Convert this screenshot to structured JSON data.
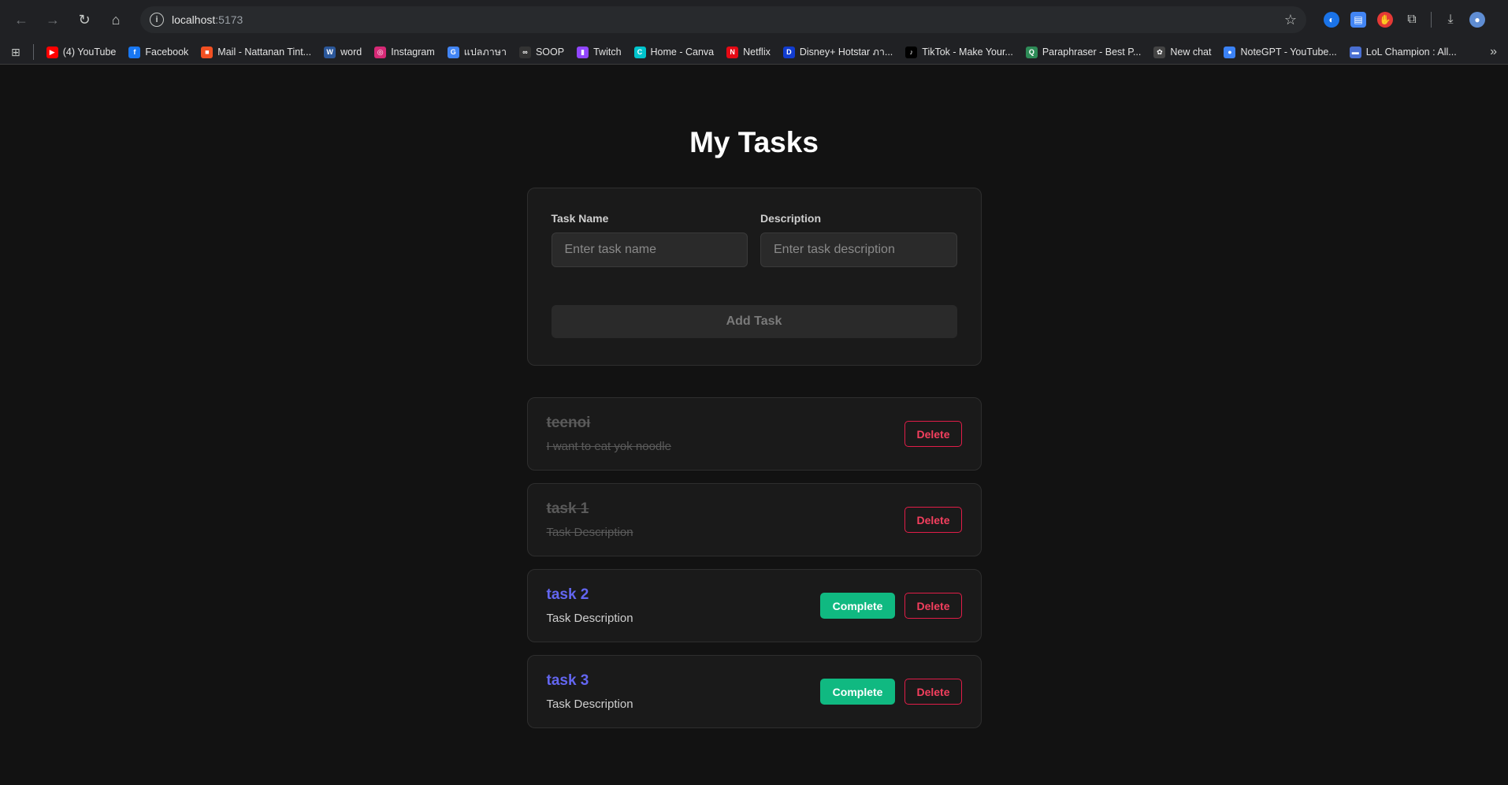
{
  "browser": {
    "url_host": "localhost",
    "url_port": ":5173",
    "bookmarks": [
      {
        "label": "(4) YouTube",
        "icon": "youtube-icon",
        "color": "#ff0000",
        "glyph": "▶"
      },
      {
        "label": "Facebook",
        "icon": "facebook-icon",
        "color": "#1877f2",
        "glyph": "f"
      },
      {
        "label": "Mail - Nattanan Tint...",
        "icon": "microsoft-icon",
        "color": "#f25022",
        "glyph": "■"
      },
      {
        "label": "word",
        "icon": "word-icon",
        "color": "#2b579a",
        "glyph": "W"
      },
      {
        "label": "Instagram",
        "icon": "instagram-icon",
        "color": "#d62976",
        "glyph": "◎"
      },
      {
        "label": "แปลภาษา",
        "icon": "translate-icon",
        "color": "#4285f4",
        "glyph": "G"
      },
      {
        "label": "SOOP",
        "icon": "soop-icon",
        "color": "#333333",
        "glyph": "∞"
      },
      {
        "label": "Twitch",
        "icon": "twitch-icon",
        "color": "#9146ff",
        "glyph": "▮"
      },
      {
        "label": "Home - Canva",
        "icon": "canva-icon",
        "color": "#00c4cc",
        "glyph": "C"
      },
      {
        "label": "Netflix",
        "icon": "netflix-icon",
        "color": "#e50914",
        "glyph": "N"
      },
      {
        "label": "Disney+ Hotstar ภา...",
        "icon": "disney-icon",
        "color": "#113ccf",
        "glyph": "D"
      },
      {
        "label": "TikTok - Make Your...",
        "icon": "tiktok-icon",
        "color": "#000000",
        "glyph": "♪"
      },
      {
        "label": "Paraphraser - Best P...",
        "icon": "paraphraser-icon",
        "color": "#2e8b57",
        "glyph": "Q"
      },
      {
        "label": "New chat",
        "icon": "chatgpt-icon",
        "color": "#444444",
        "glyph": "✿"
      },
      {
        "label": "NoteGPT - YouTube...",
        "icon": "notegpt-icon",
        "color": "#3b82f6",
        "glyph": "●"
      },
      {
        "label": "LoL Champion : All...",
        "icon": "lol-icon",
        "color": "#4a6fd1",
        "glyph": "▬"
      }
    ]
  },
  "app": {
    "title": "My Tasks",
    "form": {
      "name_label": "Task Name",
      "name_placeholder": "Enter task name",
      "name_value": "",
      "desc_label": "Description",
      "desc_placeholder": "Enter task description",
      "desc_value": "",
      "add_label": "Add Task"
    },
    "complete_label": "Complete",
    "delete_label": "Delete",
    "tasks": [
      {
        "name": "teenoi",
        "description": "I want to eat yok noodle",
        "completed": true
      },
      {
        "name": "task 1",
        "description": "Task Description",
        "completed": true
      },
      {
        "name": "task 2",
        "description": "Task Description",
        "completed": false
      },
      {
        "name": "task 3",
        "description": "Task Description",
        "completed": false
      }
    ]
  },
  "colors": {
    "accent": "#6366f1",
    "complete": "#10b981",
    "delete": "#f43f5e",
    "background": "#121212"
  }
}
